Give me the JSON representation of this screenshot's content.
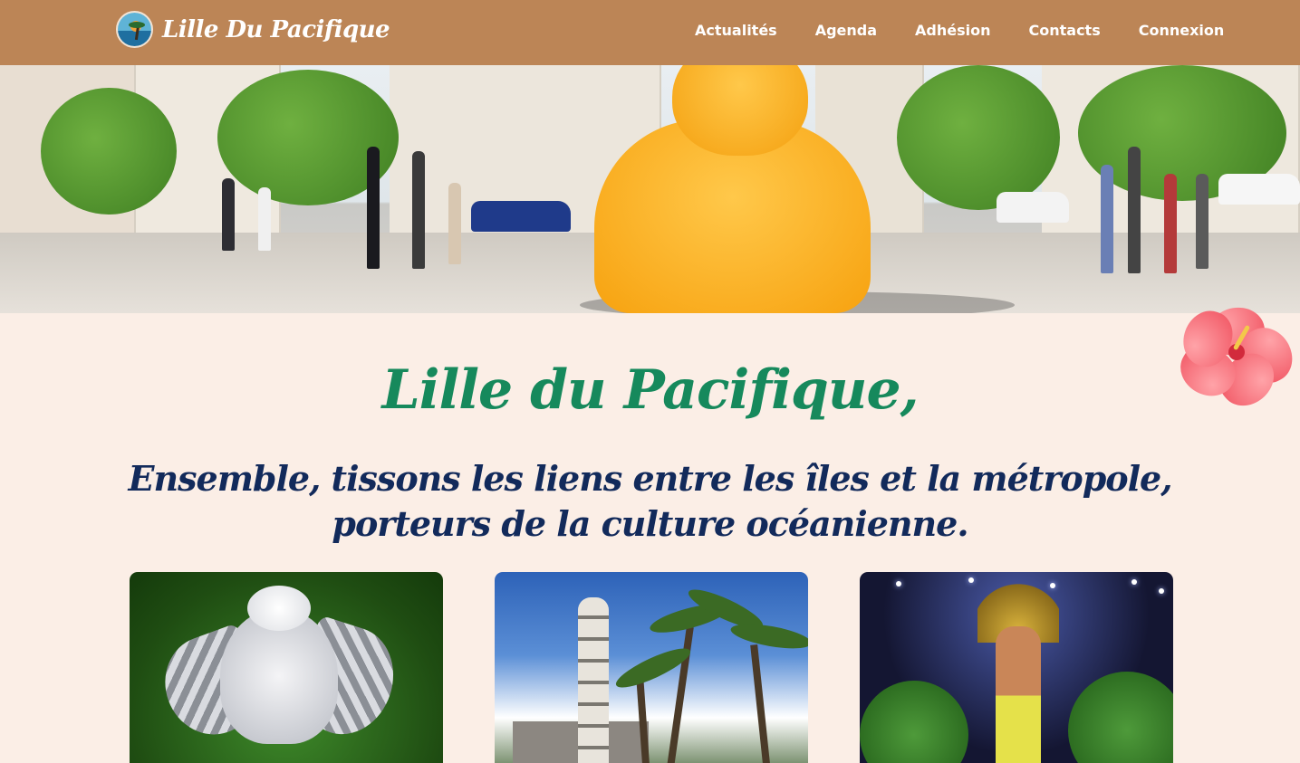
{
  "site": {
    "name": "Lille Du Pacifique"
  },
  "nav": {
    "items": [
      {
        "label": "Actualités"
      },
      {
        "label": "Agenda"
      },
      {
        "label": "Adhésion"
      },
      {
        "label": "Contacts"
      },
      {
        "label": "Connexion"
      }
    ]
  },
  "hero": {
    "title": "Lille du Pacifique,",
    "subtitle_line1": "Ensemble, tissons les liens entre les îles et la métropole,",
    "subtitle_line2": "porteurs de la culture océanienne."
  },
  "colors": {
    "header_bg": "#bc8556",
    "page_bg": "#fbeee6",
    "title_green": "#16895c",
    "subtitle_navy": "#122a5b"
  },
  "cards": [
    {
      "icon": "kagu-bird-photo"
    },
    {
      "icon": "church-tower-palms-photo"
    },
    {
      "icon": "polynesian-dancer-photo"
    }
  ]
}
